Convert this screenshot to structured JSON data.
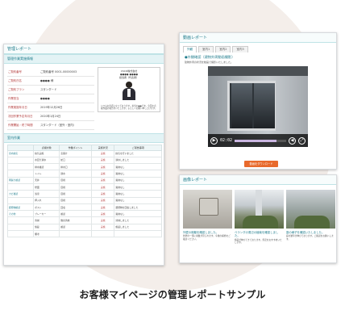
{
  "left_panel": {
    "title": "管理レポート",
    "info_section_title": "管理作業実施情報",
    "info_rows": [
      {
        "key": "ご契約番号",
        "value": "ご契約番号 0001-00000003"
      },
      {
        "key": "ご契約氏名",
        "value": "●●●● 様"
      },
      {
        "key": "ご契約プラン",
        "value": "スタンダード"
      },
      {
        "key": "作業担当",
        "value": "●●●●"
      },
      {
        "key": "作業実施年月日",
        "value": "2019年12月26日"
      },
      {
        "key": "次回作業予定年月日",
        "value": "2020年1月24日"
      },
      {
        "key": "作業開始・終了時間",
        "value": "スタンダード（室外・室内）"
      }
    ],
    "profile": {
      "company": "CSCO株式会社",
      "name": "●●●● ●●●●",
      "role": "担当者（代表者）",
      "description": "いつもお世話になっております。担当の●●です。今回の点検作業の報告をいたします。よろしくお願い申し上げます。"
    },
    "work_section_title": "室内作業",
    "work_headers": [
      "",
      "点検対象",
      "作業ポイント",
      "実施状況",
      "ご報告事項"
    ],
    "work_rows": [
      [
        "室内換気",
        "換気実施",
        "窓開け",
        "実施",
        "換気を行いました"
      ],
      [
        "",
        "水回り通水",
        "蛇口",
        "実施",
        "通水しました"
      ],
      [
        "",
        "排水確認",
        "排水口",
        "実施",
        "異常なし"
      ],
      [
        "",
        "トイレ",
        "通水",
        "実施",
        "異常なし"
      ],
      [
        "雨漏り確認",
        "天井",
        "目視",
        "実施",
        "異常なし"
      ],
      [
        "",
        "壁面",
        "目視",
        "実施",
        "異常なし"
      ],
      [
        "カビ確認",
        "浴室",
        "目視",
        "実施",
        "異常なし"
      ],
      [
        "",
        "押入れ",
        "目視",
        "実施",
        "異常なし"
      ],
      [
        "郵便物確認",
        "ポスト",
        "回収",
        "実施",
        "郵便物を回収しました"
      ],
      [
        "その他",
        "ブレーカー",
        "確認",
        "実施",
        "異常なし"
      ],
      [
        "",
        "清掃",
        "簡易清掃",
        "実施",
        "清掃しました"
      ],
      [
        "",
        "施錠",
        "確認",
        "実施",
        "施錠しました"
      ],
      [
        "",
        "備考",
        "",
        "",
        ""
      ]
    ]
  },
  "right_top": {
    "title": "動画レポート",
    "tabs": [
      "外観",
      "室内1",
      "室内2",
      "室内3"
    ],
    "video_heading": "●外観確認（建物外周動画撮影）",
    "video_sub": "建物外周の状況を動画で撮影いたしました。",
    "player": {
      "time": "02:02",
      "progress_pct": 82
    },
    "download_label": "動画をダウンロード"
  },
  "right_bottom": {
    "title": "画像レポート",
    "photos": [
      {
        "caption": "外壁の剥離を確認しました。",
        "desc": "外壁の一部に剥離が見られます。今後の補修をご検討ください。"
      },
      {
        "caption": "ベランダの周辺の植栽を確認しました。",
        "desc": "植栽が伸びてきております。剪定をおすすめいたします。"
      },
      {
        "caption": "庭の様子を確認いたしました。",
        "desc": "庭の雑草が伸びております。ご確認をお願いします。"
      }
    ]
  },
  "caption": "お客様マイページの管理レポートサンプル"
}
